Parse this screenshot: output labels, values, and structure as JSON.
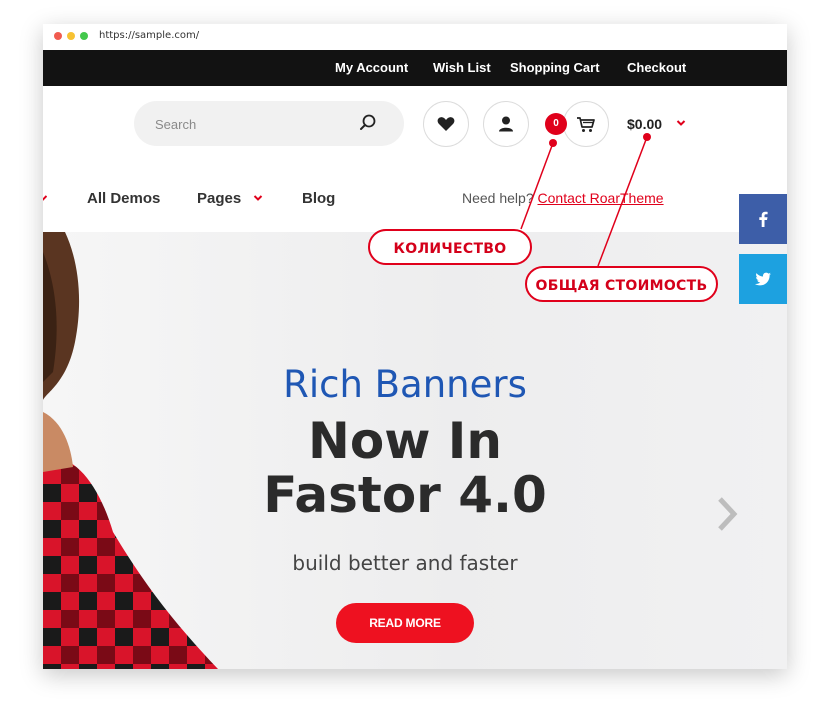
{
  "browser": {
    "url": "https://sample.com/"
  },
  "topbar": {
    "links": [
      {
        "label": "My Account"
      },
      {
        "label": "Wish List"
      },
      {
        "label": "Shopping Cart"
      },
      {
        "label": "Checkout"
      }
    ]
  },
  "header": {
    "search_placeholder": "Search",
    "cart_count": "0",
    "cart_total": "$0.00"
  },
  "nav": {
    "items": [
      {
        "label": "All Demos"
      },
      {
        "label": "Pages"
      },
      {
        "label": "Blog"
      }
    ],
    "help_text": "Need help?",
    "help_link": "Contact RoarTheme"
  },
  "hero": {
    "subtitle": "Rich Banners",
    "title_line1": "Now In",
    "title_line2": "Fastor 4.0",
    "tagline": "build better and faster",
    "cta": "READ MORE"
  },
  "annotations": {
    "quantity": "КОЛИЧЕСТВО",
    "total_cost": "ОБЩАЯ СТОИМОСТЬ"
  },
  "colors": {
    "accent_red": "#e0001b",
    "topbar_bg": "#121212",
    "hero_title_blue": "#1f57b4",
    "facebook": "#3d5ea8",
    "twitter": "#1da1e0"
  }
}
